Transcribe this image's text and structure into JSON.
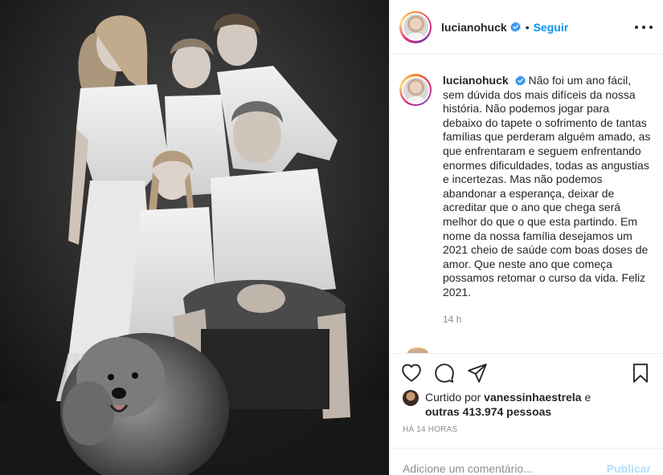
{
  "post": {
    "username": "lucianohuck",
    "verified": true,
    "follow_label": "Seguir",
    "separator": "•",
    "more_icon": "more-horizontal-icon",
    "caption": "Não foi um ano fácil, sem dúvida dos mais difíceis da nossa história. Não podemos jogar para debaixo do tapete o sofrimento de tantas famílias que perderam alguém amado, as que enfrentaram e seguem enfrentando enormes dificuldades, todas as angustias e incertezas. Mas não podemos abandonar a esperança, deixar de acreditar que o ano que chega será melhor do que o que esta partindo. Em nome da nossa família desejamos um 2021 cheio de saúde com boas doses de amor. Que neste ano que começa possamos retomar o curso da vida. Feliz 2021.",
    "caption_age": "14 h"
  },
  "actions": {
    "like_icon": "heart-icon",
    "comment_icon": "comment-icon",
    "share_icon": "share-icon",
    "save_icon": "bookmark-icon"
  },
  "likes": {
    "prefix": "Curtido por",
    "user": "vanessinhaestrela",
    "joiner": "e",
    "others": "outras 413.974 pessoas"
  },
  "posted_time": "HÁ 14 HORAS",
  "comment": {
    "placeholder": "Adicione um comentário...",
    "submit_label": "Publicar"
  },
  "colors": {
    "accent": "#0095f6",
    "publish_disabled": "#b2dffc",
    "muted": "#8e8e8e",
    "text": "#262626"
  }
}
